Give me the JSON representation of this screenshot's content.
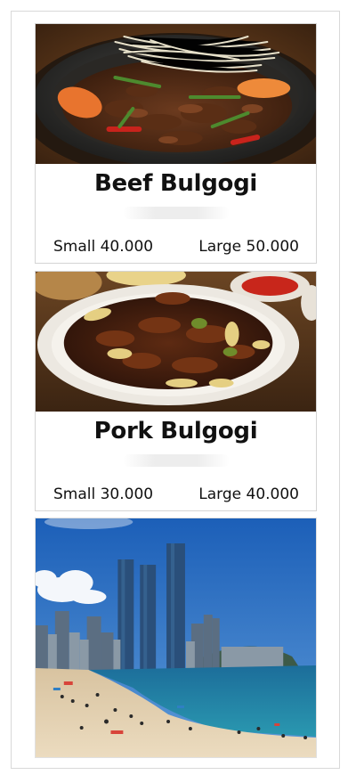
{
  "menu": [
    {
      "title": "Beef Bulgogi",
      "prices": [
        "Small 40.000",
        "Large 50.000"
      ],
      "image_subject": "Beef bulgogi on sizzling hot stone plate"
    },
    {
      "title": "Pork Bulgogi",
      "prices": [
        "Small 30.000",
        "Large 40.000"
      ],
      "image_subject": "Pork bulgogi on white plate"
    }
  ],
  "banner": {
    "image_subject": "City beach with skyscrapers"
  },
  "colors": {
    "card_border": "#d4d4d4",
    "text": "#111111",
    "page_bg": "#ffffff"
  }
}
